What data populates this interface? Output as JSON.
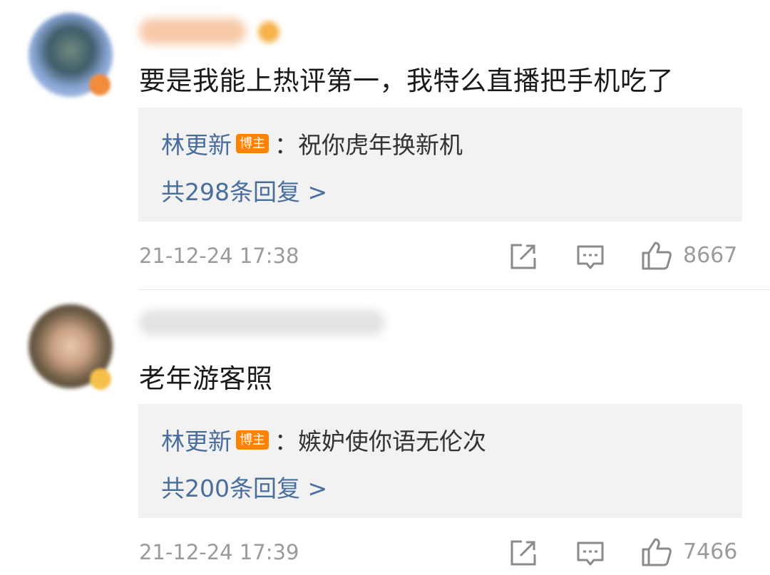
{
  "comments": [
    {
      "content": "要是我能上热评第一，我特么直播把手机吃了",
      "reply": {
        "author": "林更新",
        "tag": "博主",
        "separator": "：",
        "text": "祝你虎年换新机",
        "count_text": "共298条回复 >"
      },
      "time": "21-12-24 17:38",
      "likes": "8667",
      "icons": [
        "share-icon",
        "comment-icon",
        "like-icon"
      ]
    },
    {
      "content": "老年游客照",
      "reply": {
        "author": "林更新",
        "tag": "博主",
        "separator": "：",
        "text": "嫉妒使你语无伦次",
        "count_text": "共200条回复 >"
      },
      "time": "21-12-24 17:39",
      "likes": "7466",
      "icons": [
        "share-icon",
        "comment-icon",
        "like-icon"
      ]
    }
  ],
  "colors": {
    "link": "#4a6e9c",
    "blogger_tag": "#ff8200",
    "meta": "#9b9b9b",
    "reply_bg": "#f2f2f2"
  }
}
